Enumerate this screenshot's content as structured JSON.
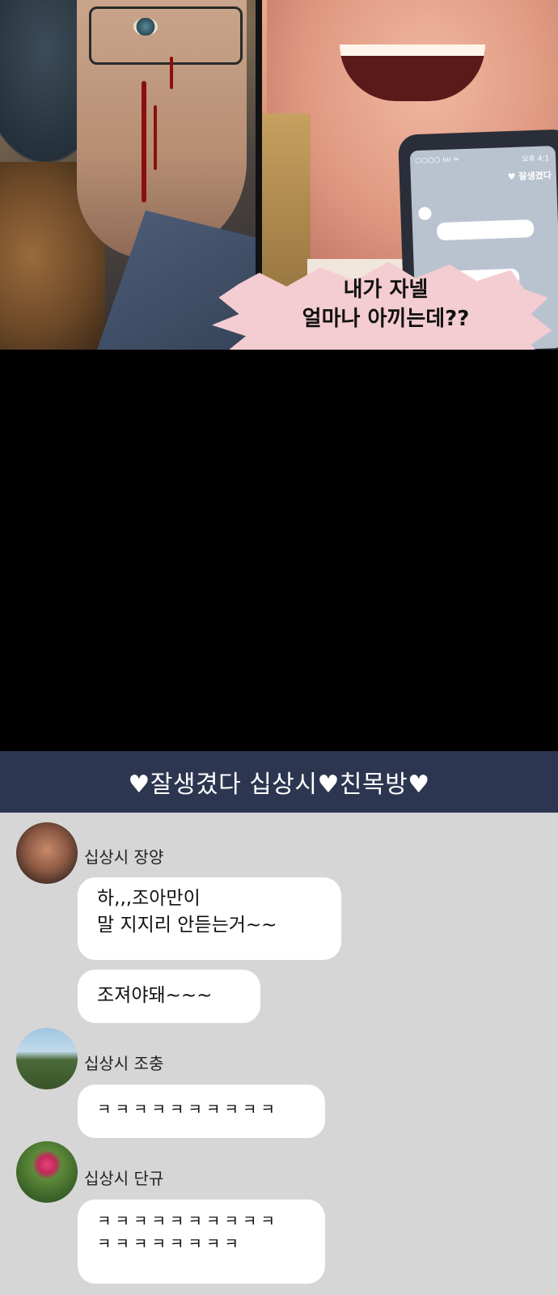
{
  "comic_panel": {
    "speech_bubble": {
      "line1": "내가 자넬",
      "line2": "얼마나 아끼는데??"
    },
    "phone": {
      "status": "○○○○ ıııı ≈",
      "time": "오후 4:1",
      "title": "♥ 잘생겼다"
    }
  },
  "chat": {
    "title": "♥잘생겼다 십상시♥친목방♥",
    "header_color": "#2d3650",
    "background_color": "#d6d6d6",
    "messages": [
      {
        "sender": "십상시 장양",
        "bubbles": [
          [
            "하,,,조아만이",
            "말 지지리 안듣는거~~"
          ],
          [
            "조져야돼~~~"
          ]
        ]
      },
      {
        "sender": "십상시 조충",
        "bubbles": [
          [
            "ㅋㅋㅋㅋㅋㅋㅋㅋㅋㅋ"
          ]
        ]
      },
      {
        "sender": "십상시 단규",
        "bubbles": [
          [
            "ㅋㅋㅋㅋㅋㅋㅋㅋㅋㅋ",
            "ㅋㅋㅋㅋㅋㅋㅋㅋ"
          ]
        ]
      }
    ]
  }
}
